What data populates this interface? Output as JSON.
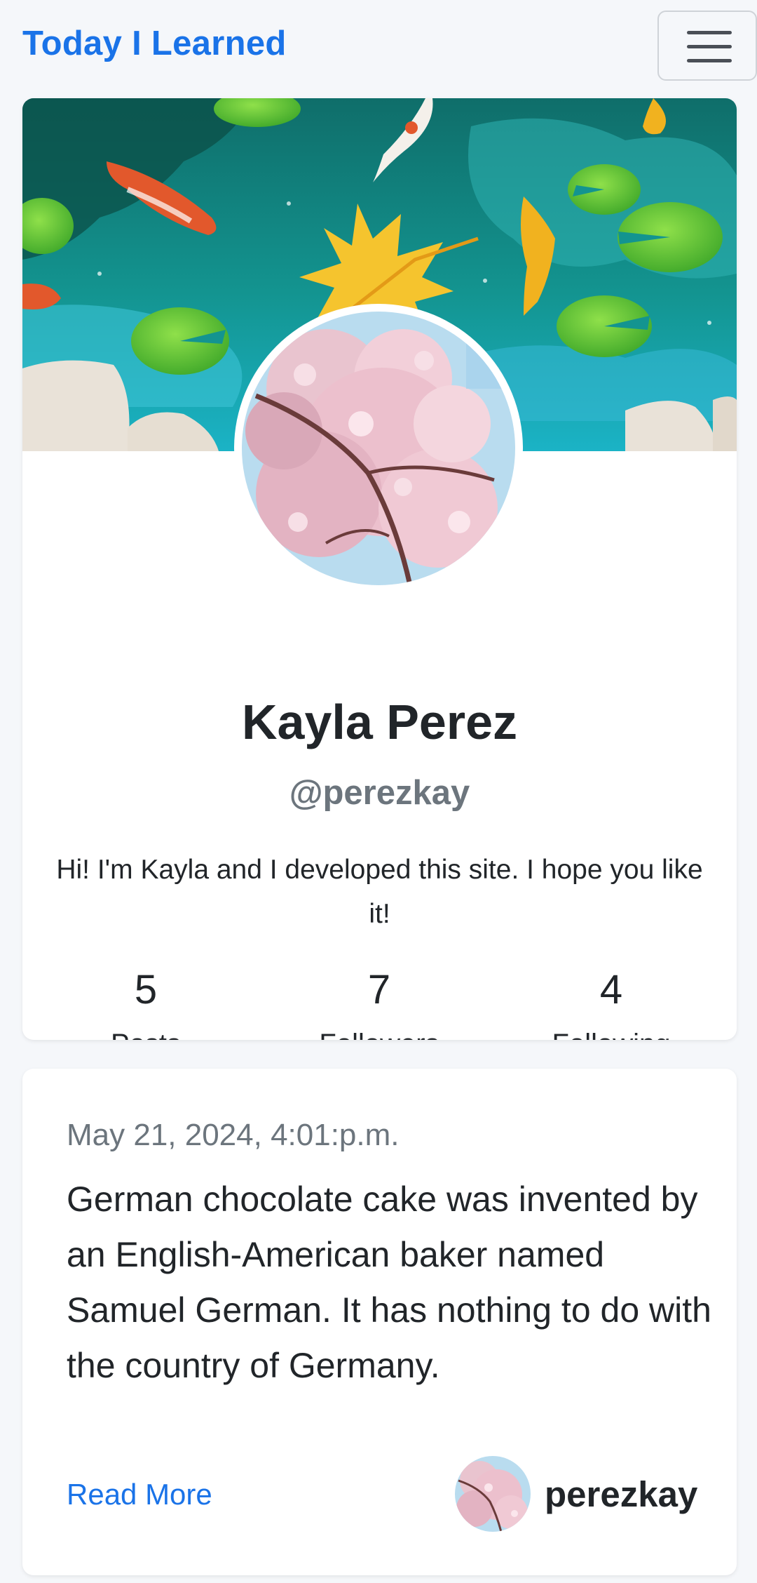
{
  "navbar": {
    "brand": "Today I Learned",
    "menu_icon": "hamburger-menu-icon"
  },
  "profile": {
    "cover_image": "koi-pond-illustration",
    "avatar_image": "cherry-blossom-photo",
    "name": "Kayla Perez",
    "handle": "@perezkay",
    "bio": "Hi! I'm Kayla and I developed this site. I hope you like it!",
    "stats": [
      {
        "value": "5",
        "label": "Posts"
      },
      {
        "value": "7",
        "label": "Followers"
      },
      {
        "value": "4",
        "label": "Following"
      }
    ]
  },
  "post": {
    "date": "May 21, 2024, 4:01:p.m.",
    "body": "German chocolate cake was invented by an English-American baker named Samuel German. It has nothing to do with the country of Germany.",
    "read_more": "Read More",
    "author": "perezkay"
  },
  "colors": {
    "accent": "#1a73e8",
    "muted": "#6c757d",
    "background": "#f5f7fa",
    "card": "#ffffff"
  }
}
